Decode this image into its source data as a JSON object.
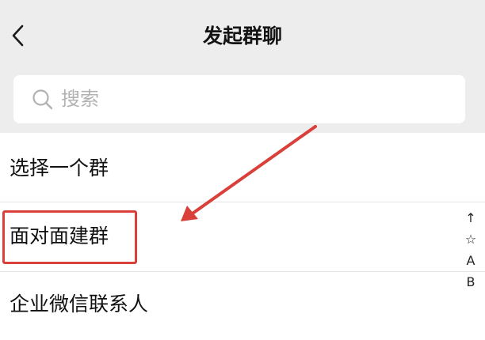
{
  "header": {
    "title": "发起群聊",
    "back_icon": "chevron-left-icon",
    "background": "#ededed"
  },
  "search": {
    "placeholder": "搜索",
    "icon": "search-icon"
  },
  "rows": [
    {
      "label": "选择一个群"
    },
    {
      "label": "面对面建群",
      "highlighted": true
    },
    {
      "label": "企业微信联系人"
    }
  ],
  "index_bar": [
    "↑",
    "☆",
    "A",
    "B"
  ],
  "annotation": {
    "color": "#d9403a"
  }
}
